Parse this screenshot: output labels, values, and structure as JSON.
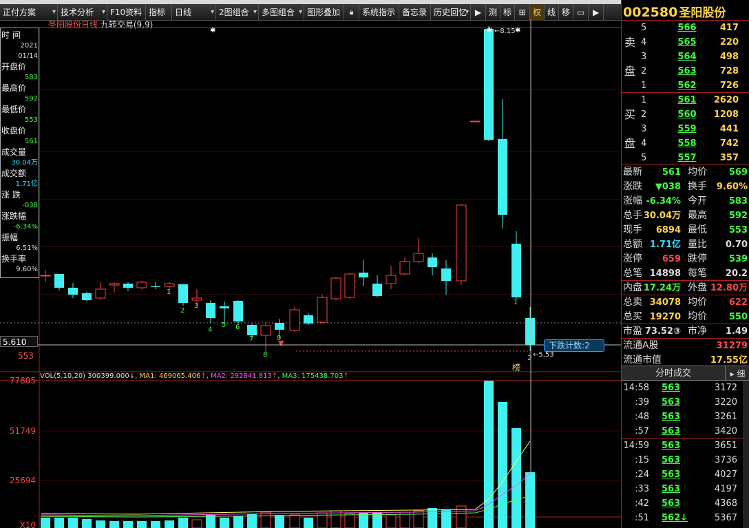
{
  "toolbar": {
    "items": [
      "正付方案",
      "技术分析",
      "F10资料",
      "指标",
      "日线",
      "2图组合",
      "多图组合",
      "图形叠加",
      "系统指示",
      "备忘录",
      "历史回忆",
      "测",
      "标",
      "权",
      "线",
      "移"
    ]
  },
  "chart": {
    "stock_name": "圣阳股份",
    "period": "日线",
    "indicator": "九转交易",
    "indicator_params": "(9,9)",
    "high_label": "8.15",
    "low_label": "5.53",
    "crosshair_price": "5.610",
    "left_price": "553",
    "countdown_label": "下跌计数:2",
    "bang_label": "榜"
  },
  "info_panel": [
    {
      "label": "时 间",
      "value": "2021",
      "value2": "01/14",
      "color": "w"
    },
    {
      "label": "开盘价",
      "value": "583",
      "color": "g"
    },
    {
      "label": "最高价",
      "value": "592",
      "color": "g"
    },
    {
      "label": "最低价",
      "value": "553",
      "color": "g"
    },
    {
      "label": "收盘价",
      "value": "561",
      "color": "g"
    },
    {
      "label": "成交量",
      "value": "30.04万",
      "color": "c"
    },
    {
      "label": "成交额",
      "value": "1.71亿",
      "color": "c"
    },
    {
      "label": "涨 跌",
      "value": "-038",
      "color": "g"
    },
    {
      "label": "涨跌幅",
      "value": "-6.34%",
      "color": "g"
    },
    {
      "label": "振幅",
      "value": "6.51%",
      "color": "w"
    },
    {
      "label": "换手率",
      "value": "9.60%",
      "color": "w"
    }
  ],
  "volume": {
    "title": "VOL(5,10,20)",
    "vol": "300399.000",
    "ma1": "MA1: 469065.406",
    "ma2": "MA2: 292841.813",
    "ma3": "MA3: 175438.703",
    "ticks": [
      "77805",
      "51749",
      "25694",
      "X10"
    ]
  },
  "right_panel": {
    "code": "002580",
    "name": "圣阳股份",
    "sell_label": [
      "卖",
      "盘"
    ],
    "buy_label": [
      "买",
      "盘"
    ],
    "sell": [
      {
        "level": "5",
        "price": "566",
        "vol": "417"
      },
      {
        "level": "4",
        "price": "565",
        "vol": "220"
      },
      {
        "level": "3",
        "price": "564",
        "vol": "498"
      },
      {
        "level": "2",
        "price": "563",
        "vol": "728"
      },
      {
        "level": "1",
        "price": "562",
        "vol": "726"
      }
    ],
    "buy": [
      {
        "level": "1",
        "price": "561",
        "vol": "2620"
      },
      {
        "level": "2",
        "price": "560",
        "vol": "1208"
      },
      {
        "level": "3",
        "price": "559",
        "vol": "441"
      },
      {
        "level": "4",
        "price": "558",
        "vol": "742"
      },
      {
        "level": "5",
        "price": "557",
        "vol": "357"
      }
    ],
    "quotes": [
      {
        "l1": "最新",
        "v1": "561",
        "c1": "g",
        "l2": "均价",
        "v2": "569",
        "c2": "g"
      },
      {
        "l1": "涨跌",
        "v1": "▼038",
        "c1": "g",
        "l2": "换手",
        "v2": "9.60%",
        "c2": "y"
      },
      {
        "l1": "涨幅",
        "v1": "-6.34%",
        "c1": "g",
        "l2": "今开",
        "v2": "583",
        "c2": "g"
      },
      {
        "l1": "总手",
        "v1": "30.04万",
        "c1": "y",
        "l2": "最高",
        "v2": "592",
        "c2": "g"
      },
      {
        "l1": "现手",
        "v1": "6894",
        "c1": "y",
        "l2": "最低",
        "v2": "553",
        "c2": "g"
      },
      {
        "l1": "总额",
        "v1": "1.71亿",
        "c1": "c",
        "l2": "量比",
        "v2": "0.70",
        "c2": "w"
      },
      {
        "l1": "涨停",
        "v1": "659",
        "c1": "r",
        "l2": "跌停",
        "v2": "539",
        "c2": "g"
      },
      {
        "l1": "总笔",
        "v1": "14898",
        "c1": "w",
        "l2": "每笔",
        "v2": "20.2",
        "c2": "w"
      },
      {
        "l1": "内盘",
        "v1": "17.24万",
        "c1": "g",
        "l2": "外盘",
        "v2": "12.80万",
        "c2": "r"
      },
      {
        "l1": "总卖",
        "v1": "34078",
        "c1": "y",
        "l2": "均价",
        "v2": "622",
        "c2": "r"
      },
      {
        "l1": "总买",
        "v1": "19270",
        "c1": "y",
        "l2": "均价",
        "v2": "550",
        "c2": "g"
      },
      {
        "l1": "市盈",
        "v1": "73.52③",
        "c1": "w",
        "l2": "市净",
        "v2": "1.49",
        "c2": "w"
      },
      {
        "l1": "流通A股",
        "v1": "",
        "c1": "w",
        "l2": "",
        "v2": "31279",
        "c2": "r"
      },
      {
        "l1": "流通市值",
        "v1": "",
        "c1": "w",
        "l2": "",
        "v2": "17.55亿",
        "c2": "y"
      }
    ],
    "fs_title": "分时成交",
    "fs_btn": "▸ 细",
    "ticks": [
      {
        "t": "14:58",
        "p": "563",
        "v": "3172"
      },
      {
        "t": ":39",
        "p": "563",
        "v": "3220"
      },
      {
        "t": ":48",
        "p": "563",
        "v": "3261"
      },
      {
        "t": ":57",
        "p": "563",
        "v": "3420"
      },
      {
        "t": "14:59",
        "p": "563",
        "v": "3651"
      },
      {
        "t": ":15",
        "p": "563",
        "v": "3736"
      },
      {
        "t": ":24",
        "p": "563",
        "v": "4027"
      },
      {
        "t": ":33",
        "p": "563",
        "v": "4197"
      },
      {
        "t": ":42",
        "p": "563",
        "v": "4368"
      },
      {
        "t": ":51",
        "p": "562↓",
        "v": "5367"
      }
    ]
  }
}
